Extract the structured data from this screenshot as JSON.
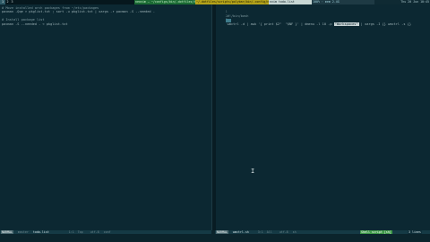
{
  "topbar": {
    "workspaces": [
      "1",
      "2",
      "3"
    ],
    "active_workspace": "1",
    "window_title": "neovim — ~/configs/bin/.dotfiles/todo.list",
    "path": "~/.dotfiles/scripts/polybar/bin/.config/nvim",
    "cmd": "nvim todo.list",
    "info": "100% · mem 2.4G",
    "time": "Thu 20 Jun 10:45"
  },
  "left_pane": {
    "lines": [
      "# Move installed arch packages from ~/etc/packages",
      "pacman -Qqe > pkglist.txt ; sort -u pkglist.txt | xargs -r pacman -S --needed -",
      "",
      "# Install package list",
      "pacman -S --needed - < pkglist.txt"
    ]
  },
  "right_pane": {
    "lines": [
      {
        "num": "1",
        "text": "#!/bin/bash"
      },
      {
        "num": "2",
        "text": ""
      },
      {
        "num": "3",
        "pre": "wmctrl -d | awk '{ print $2\"  \"$NF }' | dmenu -l 10 -p ",
        "hl": "\"Workspaces\"",
        "post": " | xargs -I {} wmctrl -s {}"
      }
    ]
  },
  "statusline_left": {
    "mode": "NORMAL",
    "branch": "master",
    "file": "todo.list",
    "pos": "1:1",
    "percent": "Top",
    "encoding": "utf-8",
    "filetype": "conf"
  },
  "statusline_right": {
    "mode": "NORMAL",
    "file": "wmctrl.sh",
    "pos": "3:1",
    "percent": "All",
    "encoding": "utf-8",
    "filetype": "sh",
    "ft_label": "Shell script [sh]",
    "count": "3 lines"
  }
}
